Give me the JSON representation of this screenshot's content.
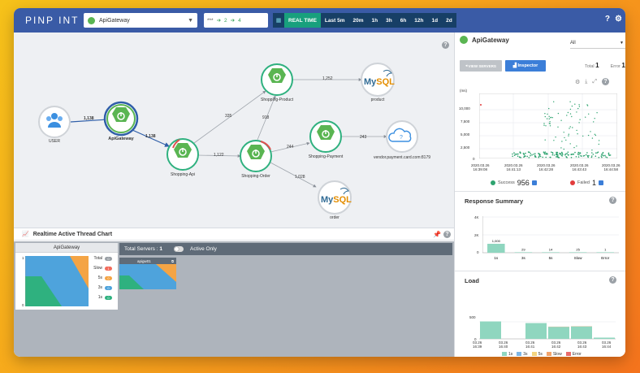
{
  "colors": {
    "brand": "#3a5ba6",
    "nav_dark": "#173f66",
    "realtime": "#18a07d",
    "spring_green": "#5ab552",
    "success": "#2ea36f",
    "failed": "#e23c3c",
    "load_1s": "#8fd6bf",
    "load_3s": "#7fb7e6",
    "load_5s": "#f4d47f",
    "load_slow": "#f2a46c",
    "load_error": "#e96c6c"
  },
  "header": {
    "logo": "PINP   INT",
    "app_name": "ApiGateway",
    "filter": {
      "stars": "***",
      "in_count": "2",
      "out_count": "4"
    },
    "realtime_label": "REAL TIME",
    "ranges": [
      "Last 5m",
      "20m",
      "1h",
      "3h",
      "6h",
      "12h",
      "1d",
      "2d"
    ],
    "help_icon": "help-icon",
    "settings_icon": "gear-icon"
  },
  "servermap": {
    "nodes": {
      "user": "USER",
      "gateway": "ApiGateway",
      "api": "Shopping-Api",
      "order": "Shopping-Order",
      "product": "Shopping-Product",
      "payment": "Shopping-Payment",
      "mysql_product": "product",
      "mysql_order": "order",
      "vendor": "vendor.payment.card.com:8179"
    },
    "edges": {
      "user_gateway": "1,138",
      "gateway_api": "1,138",
      "api_order": "1,122",
      "api_product": "335",
      "order_product": "918",
      "product_mysql": "1,252",
      "order_payment": "244",
      "payment_vendor": "243",
      "order_mysql": "1,028"
    },
    "mysql_text": "MySQL"
  },
  "thread_chart": {
    "title": "Realtime Active Thread Chart",
    "aggregate_title": "ApiGateway",
    "legend": [
      {
        "label": "Total",
        "count": "0",
        "color": "#9aa0a6"
      },
      {
        "label": "Slow",
        "count": "1",
        "color": "#f26b5b"
      },
      {
        "label": "5s",
        "count": "0",
        "color": "#f4a445"
      },
      {
        "label": "3s",
        "count": "0",
        "color": "#4ea3dc"
      },
      {
        "label": "1s",
        "count": "0",
        "color": "#2fb17f"
      }
    ],
    "y_max": "1",
    "y_zero": "0",
    "total_servers_label": "Total Servers :",
    "total_servers_value": "1",
    "active_only_label": "Active Only",
    "agent_name": "apigw01"
  },
  "side_panel": {
    "app_name": "ApiGateway",
    "agent_filter": "All",
    "view_servers_label": "VIEW SERVERS",
    "inspector_label": "Inspector",
    "total_label": "Total",
    "total_value": "1",
    "error_label": "Error",
    "error_value": "1"
  },
  "scatter": {
    "y_unit": "(ms)",
    "y_ticks": [
      "10,000",
      "7,500",
      "5,000",
      "2,500",
      "0"
    ],
    "x_ticks": [
      [
        "2020.03.26",
        "16:39:08"
      ],
      [
        "2020.03.26",
        "16:41:13"
      ],
      [
        "2020.03.26",
        "16:42:28"
      ],
      [
        "2020.03.26",
        "16:43:43"
      ],
      [
        "2020.03.26",
        "16:44:58"
      ]
    ],
    "success_label": "Success",
    "success_count": "956",
    "failed_label": "Failed",
    "failed_count": "1"
  },
  "response_summary": {
    "title": "Response Summary",
    "y_ticks": [
      "4K",
      "2K",
      "0"
    ],
    "categories": [
      "1s",
      "3s",
      "5s",
      "Slow",
      "Error"
    ],
    "values": [
      1000,
      29,
      14,
      25,
      1
    ],
    "value_labels": [
      "1,000",
      "29",
      "14",
      "25",
      "1"
    ]
  },
  "load": {
    "title": "Load",
    "y_ticks": [
      "500",
      "0"
    ],
    "x_ticks": [
      [
        "03.26",
        "16:39"
      ],
      [
        "03.26",
        "16:40"
      ],
      [
        "03.26",
        "16:41"
      ],
      [
        "03.26",
        "16:42"
      ],
      [
        "03.26",
        "16:43"
      ],
      [
        "03.26",
        "16:44"
      ]
    ],
    "legend": [
      "1s",
      "3s",
      "5s",
      "Slow",
      "Error"
    ]
  },
  "chart_data": [
    {
      "type": "bar",
      "title": "Response Summary",
      "categories": [
        "1s",
        "3s",
        "5s",
        "Slow",
        "Error"
      ],
      "values": [
        1000,
        29,
        14,
        25,
        1
      ],
      "ylim": [
        0,
        4000
      ]
    },
    {
      "type": "bar",
      "title": "Load",
      "categories": [
        "16:39",
        "16:40",
        "16:41",
        "16:42",
        "16:43",
        "16:44"
      ],
      "series": [
        {
          "name": "1s",
          "values": [
            420,
            0,
            380,
            290,
            300,
            30
          ]
        },
        {
          "name": "Slow",
          "values": [
            0,
            0,
            0,
            5,
            5,
            0
          ]
        }
      ],
      "ylim": [
        0,
        900
      ]
    }
  ]
}
